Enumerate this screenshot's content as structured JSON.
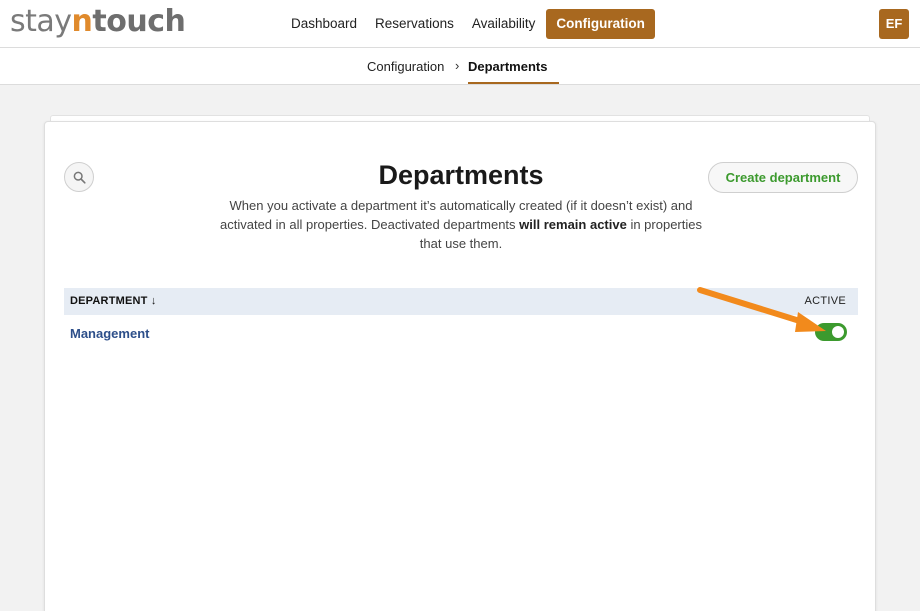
{
  "app": {
    "logo_prefix": "stay",
    "logo_n": "n",
    "logo_suffix": "touch",
    "user_initials": "EF"
  },
  "nav": {
    "items": [
      {
        "label": "Dashboard",
        "active": false
      },
      {
        "label": "Reservations",
        "active": false
      },
      {
        "label": "Availability",
        "active": false
      },
      {
        "label": "Configuration",
        "active": true
      }
    ]
  },
  "breadcrumb": {
    "parent": "Configuration",
    "separator": "›",
    "current": "Departments"
  },
  "page": {
    "title": "Departments",
    "description_part1": "When you activate a department it’s automatically created (if it doesn’t exist) and activated in all properties. Deactivated departments ",
    "description_bold": "will remain active",
    "description_part2": " in properties that use them.",
    "create_button": "Create department",
    "search_icon": "search-icon"
  },
  "table": {
    "columns": {
      "department": "DEPARTMENT ↓",
      "active": "ACTIVE"
    },
    "rows": [
      {
        "name": "Management",
        "active": true
      }
    ]
  },
  "colors": {
    "brand": "#a8681f",
    "logo_accent": "#e08a2c",
    "active_green": "#3c9a2e",
    "link_blue": "#2d4f8a",
    "annotation_arrow": "#f28a1c"
  }
}
